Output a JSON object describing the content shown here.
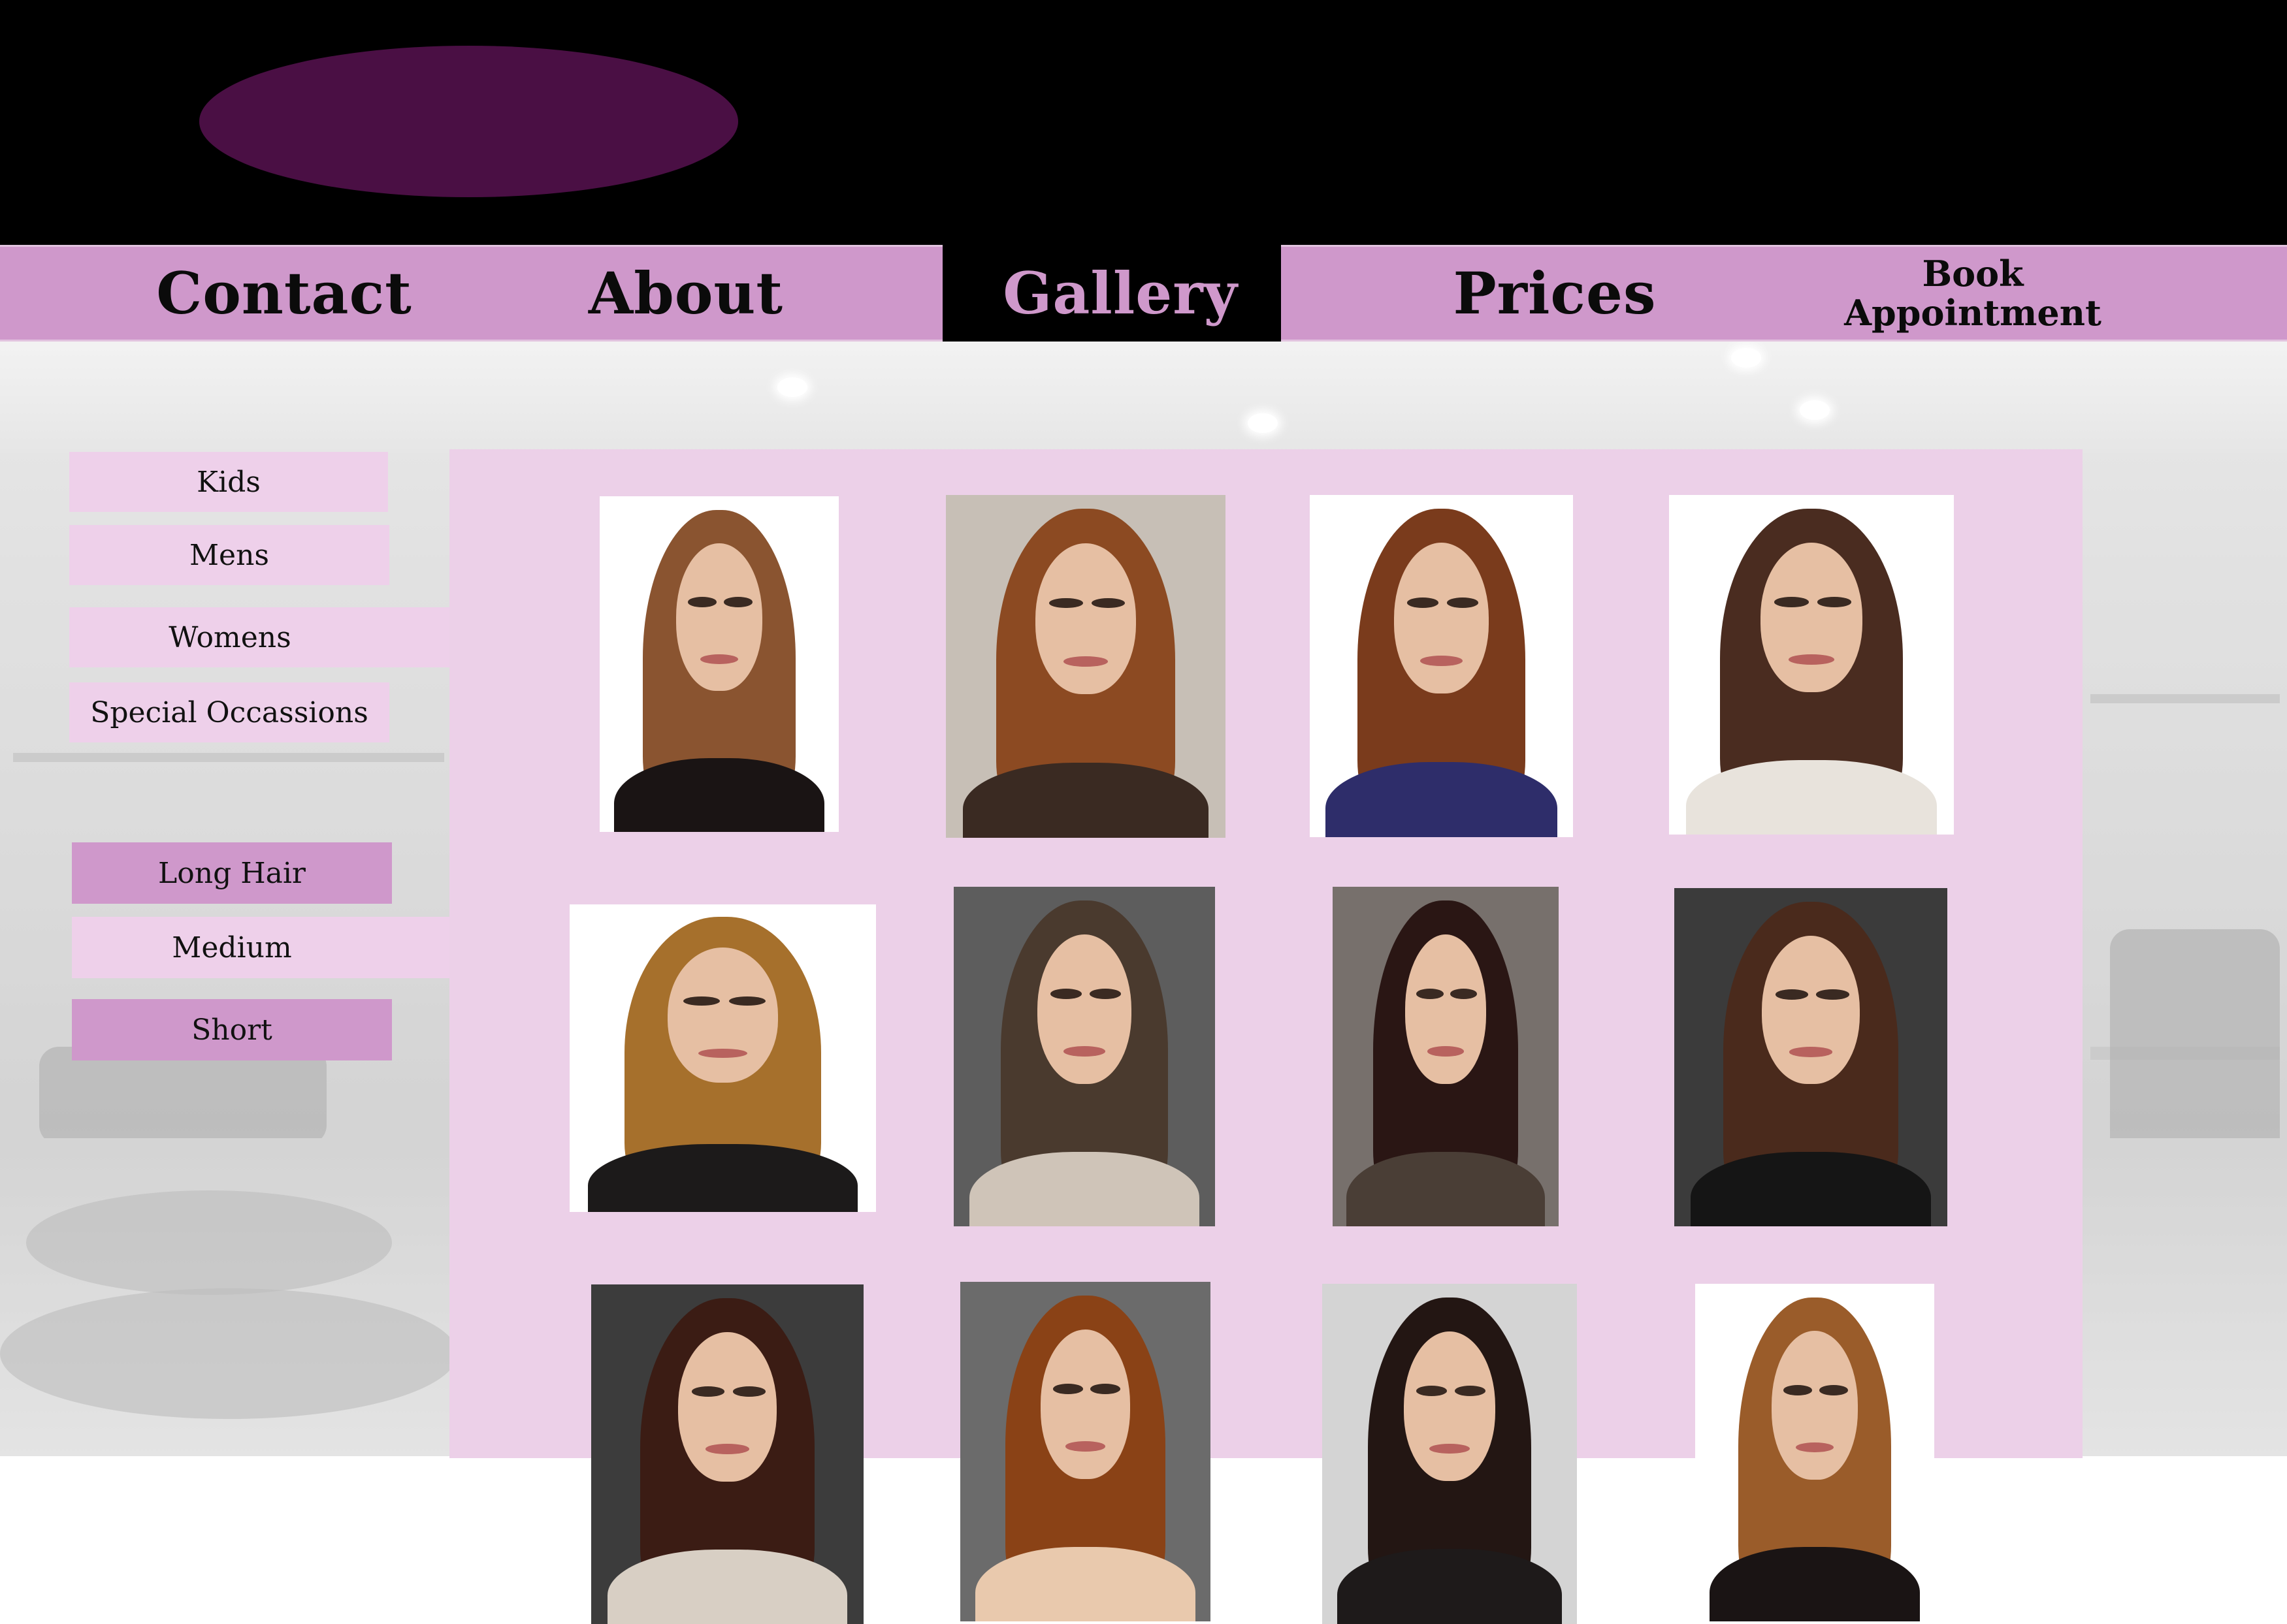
{
  "nav": {
    "items": [
      {
        "label": "Contact"
      },
      {
        "label": "About"
      },
      {
        "label": "Gallery",
        "active": true
      },
      {
        "label": "Prices"
      },
      {
        "label": "Book\nAppointment"
      }
    ]
  },
  "sidebar": {
    "categories": [
      "Kids",
      "Mens",
      "Womens",
      "Special Occassions"
    ],
    "lengths": [
      "Long Hair",
      "Medium",
      "Short"
    ]
  },
  "gallery": {
    "rows": 3,
    "columns": 4,
    "photo_count": 12
  },
  "colors": {
    "header": "#000000",
    "logo": "#4a0f44",
    "nav": "#cf98cb",
    "active_nav_text": "#cf98cb",
    "panel": "#ecd0e8",
    "sidebar_light": "#eed0ea",
    "sidebar_dark": "#cf98cb"
  }
}
